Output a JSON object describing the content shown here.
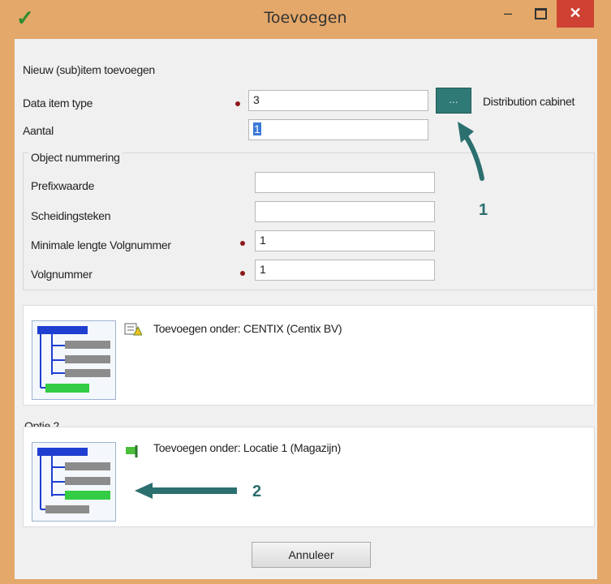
{
  "window": {
    "title": "Toevoegen",
    "minimize_glyph": "–",
    "close_glyph": "✕",
    "app_icon": "checkmark-arrow-icon"
  },
  "form": {
    "section_title": "Nieuw (sub)item toevoegen",
    "data_item_type": {
      "label": "Data item type",
      "value": "3",
      "browse_label": "...",
      "type_name": "Distribution cabinet"
    },
    "aantal": {
      "label": "Aantal",
      "value": "1"
    }
  },
  "object_nummering": {
    "title": "Object nummering",
    "prefixwaarde": {
      "label": "Prefixwaarde",
      "value": ""
    },
    "scheidingsteken": {
      "label": "Scheidingsteken",
      "value": ""
    },
    "min_lengte": {
      "label": "Minimale lengte Volgnummer",
      "value": "1"
    },
    "volgnummer": {
      "label": "Volgnummer",
      "value": "1"
    }
  },
  "option1": {
    "text": "Toevoegen onder: CENTIX (Centix BV)"
  },
  "option2": {
    "title": "Optie 2",
    "text": "Toevoegen onder: Locatie 1 (Magazijn)"
  },
  "annotations": {
    "one": "1",
    "two": "2"
  },
  "footer": {
    "cancel_label": "Annuleer"
  },
  "colors": {
    "accent": "#2f7a76",
    "window_frame": "#e4a86a",
    "close": "#cf4233",
    "tree_blue": "#1f3fd0",
    "tree_green": "#33cc44"
  }
}
